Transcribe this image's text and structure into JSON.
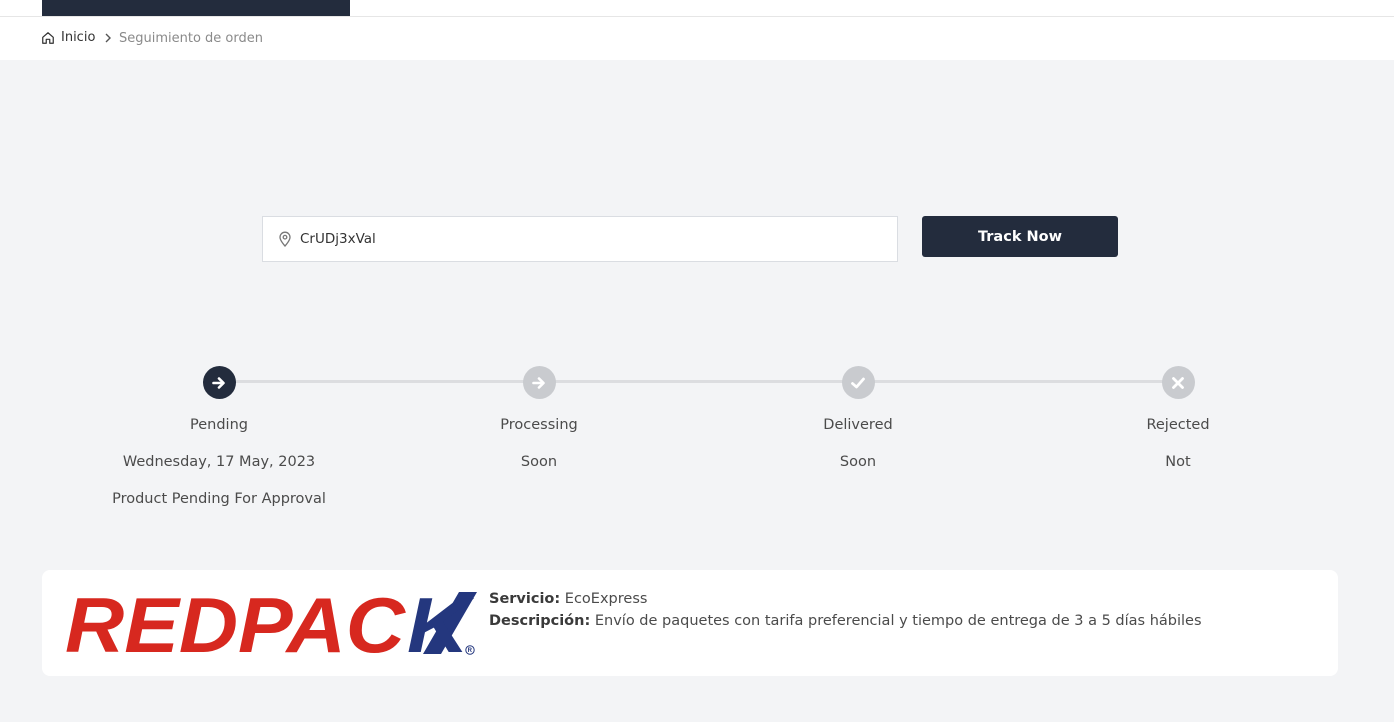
{
  "breadcrumb": {
    "home_label": "Inicio",
    "current": "Seguimiento de orden"
  },
  "search": {
    "value": "CrUDj3xVal",
    "button_label": "Track Now"
  },
  "steps": [
    {
      "label": "Pending",
      "date": "Wednesday, 17 May, 2023",
      "note": "Product Pending For Approval",
      "icon": "arrow-right-icon",
      "state": "active"
    },
    {
      "label": "Processing",
      "date": "Soon",
      "icon": "arrow-right-icon",
      "state": "idle"
    },
    {
      "label": "Delivered",
      "date": "Soon",
      "icon": "check-icon",
      "state": "idle"
    },
    {
      "label": "Rejected",
      "date": "Not",
      "icon": "close-icon",
      "state": "idle"
    }
  ],
  "carrier": {
    "logo_text": "REDPACK",
    "service_label": "Servicio:",
    "service_value": "EcoExpress",
    "description_label": "Descripción:",
    "description_value": "Envío de paquetes con tarifa preferencial y tiempo de entrega de 3 a 5 días hábiles"
  },
  "colors": {
    "accent": "#232c3d",
    "step_idle": "#c9cbcf",
    "logo_red": "#d7281f",
    "logo_blue": "#24377e"
  }
}
